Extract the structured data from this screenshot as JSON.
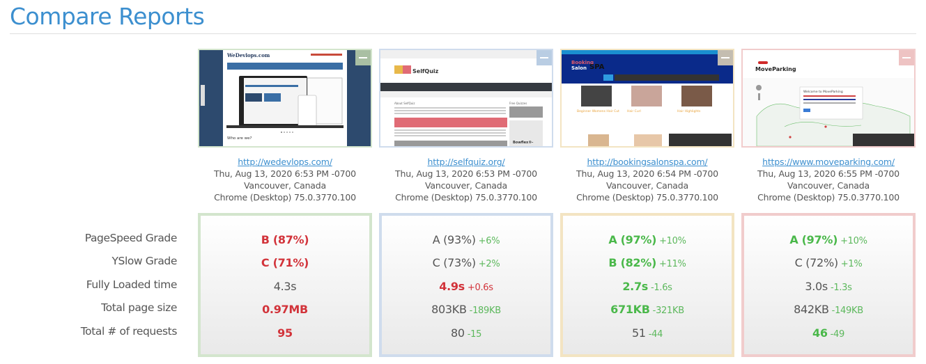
{
  "page": {
    "title": "Compare Reports"
  },
  "metric_labels": [
    "PageSpeed Grade",
    "YSlow Grade",
    "Fully Loaded time",
    "Total page size",
    "Total # of requests"
  ],
  "reports": [
    {
      "url": "http://wedevlops.com/",
      "date": "Thu, Aug 13, 2020 6:53 PM -0700",
      "location": "Vancouver, Canada",
      "browser": "Chrome (Desktop) 75.0.3770.100",
      "border_color": "#d3e5cd",
      "tag_color": "#a9bfa3",
      "thumbnail": {
        "site_name": "WeDevlops.com",
        "heading": "Who are we?"
      },
      "metrics": [
        {
          "value": "B (87%)",
          "status": "red",
          "delta": ""
        },
        {
          "value": "C (71%)",
          "status": "red",
          "delta": ""
        },
        {
          "value": "4.3s",
          "status": "gray",
          "delta": ""
        },
        {
          "value": "0.97MB",
          "status": "red",
          "delta": ""
        },
        {
          "value": "95",
          "status": "red",
          "delta": ""
        }
      ]
    },
    {
      "url": "http://selfquiz.org/",
      "date": "Thu, Aug 13, 2020 6:53 PM -0700",
      "location": "Vancouver, Canada",
      "browser": "Chrome (Desktop) 75.0.3770.100",
      "border_color": "#cfdced",
      "tag_color": "#b9cde3",
      "thumbnail": {
        "site_name": "SelfQuiz",
        "heading": "Bowflex®-"
      },
      "metrics": [
        {
          "value": "A (93%)",
          "status": "gray",
          "delta": "+6%",
          "delta_status": "green"
        },
        {
          "value": "C (73%)",
          "status": "gray",
          "delta": "+2%",
          "delta_status": "green"
        },
        {
          "value": "4.9s",
          "status": "red",
          "delta": "+0.6s",
          "delta_status": "red"
        },
        {
          "value": "803KB",
          "status": "gray",
          "delta": "-189KB",
          "delta_status": "green"
        },
        {
          "value": "80",
          "status": "gray",
          "delta": "-15",
          "delta_status": "green"
        }
      ]
    },
    {
      "url": "http://bookingsalonspa.com/",
      "date": "Thu, Aug 13, 2020 6:54 PM -0700",
      "location": "Vancouver, Canada",
      "browser": "Chrome (Desktop) 75.0.3770.100",
      "border_color": "#f3e4c2",
      "tag_color": "#c4bdb0",
      "thumbnail": {
        "site_name": "Booking Salon SPA",
        "items": [
          "Beginner Womens Hair Cut",
          "Hair Curl",
          "Hair Highlights"
        ]
      },
      "metrics": [
        {
          "value": "A (97%)",
          "status": "green",
          "delta": "+10%",
          "delta_status": "green"
        },
        {
          "value": "B (82%)",
          "status": "green",
          "delta": "+11%",
          "delta_status": "green"
        },
        {
          "value": "2.7s",
          "status": "green",
          "delta": "-1.6s",
          "delta_status": "green"
        },
        {
          "value": "671KB",
          "status": "green",
          "delta": "-321KB",
          "delta_status": "green"
        },
        {
          "value": "51",
          "status": "gray",
          "delta": "-44",
          "delta_status": "green"
        }
      ]
    },
    {
      "url": "https://www.moveparking.com/",
      "date": "Thu, Aug 13, 2020 6:55 PM -0700",
      "location": "Vancouver, Canada",
      "browser": "Chrome (Desktop) 75.0.3770.100",
      "border_color": "#f1cccc",
      "tag_color": "#eec3c3",
      "thumbnail": {
        "site_name": "MoveParking",
        "popup_title": "Welcome to MoveParking"
      },
      "metrics": [
        {
          "value": "A (97%)",
          "status": "green",
          "delta": "+10%",
          "delta_status": "green"
        },
        {
          "value": "C (72%)",
          "status": "gray",
          "delta": "+1%",
          "delta_status": "green"
        },
        {
          "value": "3.0s",
          "status": "gray",
          "delta": "-1.3s",
          "delta_status": "green"
        },
        {
          "value": "842KB",
          "status": "gray",
          "delta": "-149KB",
          "delta_status": "green"
        },
        {
          "value": "46",
          "status": "green",
          "delta": "-49",
          "delta_status": "green"
        }
      ]
    }
  ]
}
